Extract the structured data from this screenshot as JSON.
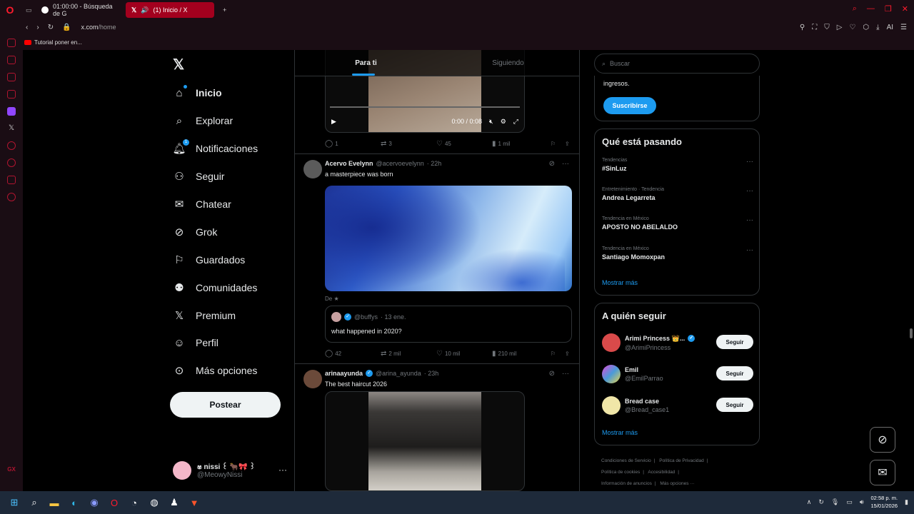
{
  "browser": {
    "tabs": [
      {
        "label": "01:00:00 - Búsqueda de G",
        "active": false
      },
      {
        "label": "(1) Inicio / X",
        "active": true
      }
    ],
    "url_host": "x.com",
    "url_path": "/home",
    "bookmark": "Tutorial poner en..."
  },
  "nav": {
    "items": [
      {
        "label": "Inicio",
        "icon": "home-icon"
      },
      {
        "label": "Explorar",
        "icon": "search-icon"
      },
      {
        "label": "Notificaciones",
        "icon": "bell-icon",
        "badge": "1"
      },
      {
        "label": "Seguir",
        "icon": "person-add-icon"
      },
      {
        "label": "Chatear",
        "icon": "mail-icon"
      },
      {
        "label": "Grok",
        "icon": "grok-icon"
      },
      {
        "label": "Guardados",
        "icon": "bookmark-icon"
      },
      {
        "label": "Comunidades",
        "icon": "communities-icon"
      },
      {
        "label": "Premium",
        "icon": "x-icon"
      },
      {
        "label": "Perfil",
        "icon": "person-icon"
      },
      {
        "label": "Más opciones",
        "icon": "more-icon"
      }
    ],
    "post_label": "Postear",
    "account": {
      "name": "ෂ nissi ꒰ 🐂🎀 ꒱",
      "handle": "@MeowyNissi"
    }
  },
  "feed": {
    "tabs": [
      "Para ti",
      "Siguiendo"
    ],
    "tweet1": {
      "video_time": "0:00 / 0:08",
      "replies": "1",
      "reposts": "3",
      "likes": "45",
      "views": "1 mil"
    },
    "tweet2": {
      "name": "Acervo Evelynn",
      "handle": "@acervoevelynn",
      "time": "· 22h",
      "text": "a masterpiece was born",
      "credit": "De ★",
      "quote": {
        "handle": "@buffys",
        "time": "· 13 ene.",
        "text": "what happened in 2020?"
      },
      "replies": "42",
      "reposts": "2 mil",
      "likes": "10 mil",
      "views": "210 mil"
    },
    "tweet3": {
      "name": "arinaayunda",
      "handle": "@arina_ayunda",
      "time": "· 23h",
      "text": "The best haircut 2026"
    }
  },
  "sidebar": {
    "search_placeholder": "Buscar",
    "premium_text": "ingresos.",
    "subscribe_label": "Suscribirse",
    "trends_title": "Qué está pasando",
    "trends": [
      {
        "context": "Tendencias",
        "title": "#SinLuz"
      },
      {
        "context": "Entretenimiento · Tendencia",
        "title": "Andrea Legarreta"
      },
      {
        "context": "Tendencia en México",
        "title": "APOSTO NO ABELALDO"
      },
      {
        "context": "Tendencia en México",
        "title": "Santiago Momoxpan"
      }
    ],
    "show_more": "Mostrar más",
    "who_title": "A quién seguir",
    "who": [
      {
        "name": "Arimi Princess 👑...",
        "handle": "@ArimiPrincess",
        "verified": true,
        "color": "#d94a4a"
      },
      {
        "name": "Emil",
        "handle": "@EmilParrao",
        "verified": false,
        "color": "#7b4ad9"
      },
      {
        "name": "Bread case",
        "handle": "@Bread_case1",
        "verified": false,
        "color": "#f0e6a8"
      }
    ],
    "follow_label": "Seguir",
    "footer": [
      "Condiciones de Servicio",
      "|",
      "Política de Privacidad",
      "|",
      "Política de cookies",
      "|",
      "Accesibilidad",
      "|",
      "Información de anuncios",
      "|",
      "Más opciones ···"
    ]
  },
  "taskbar": {
    "time": "02:58 p. m.",
    "date": "15/01/2026"
  }
}
